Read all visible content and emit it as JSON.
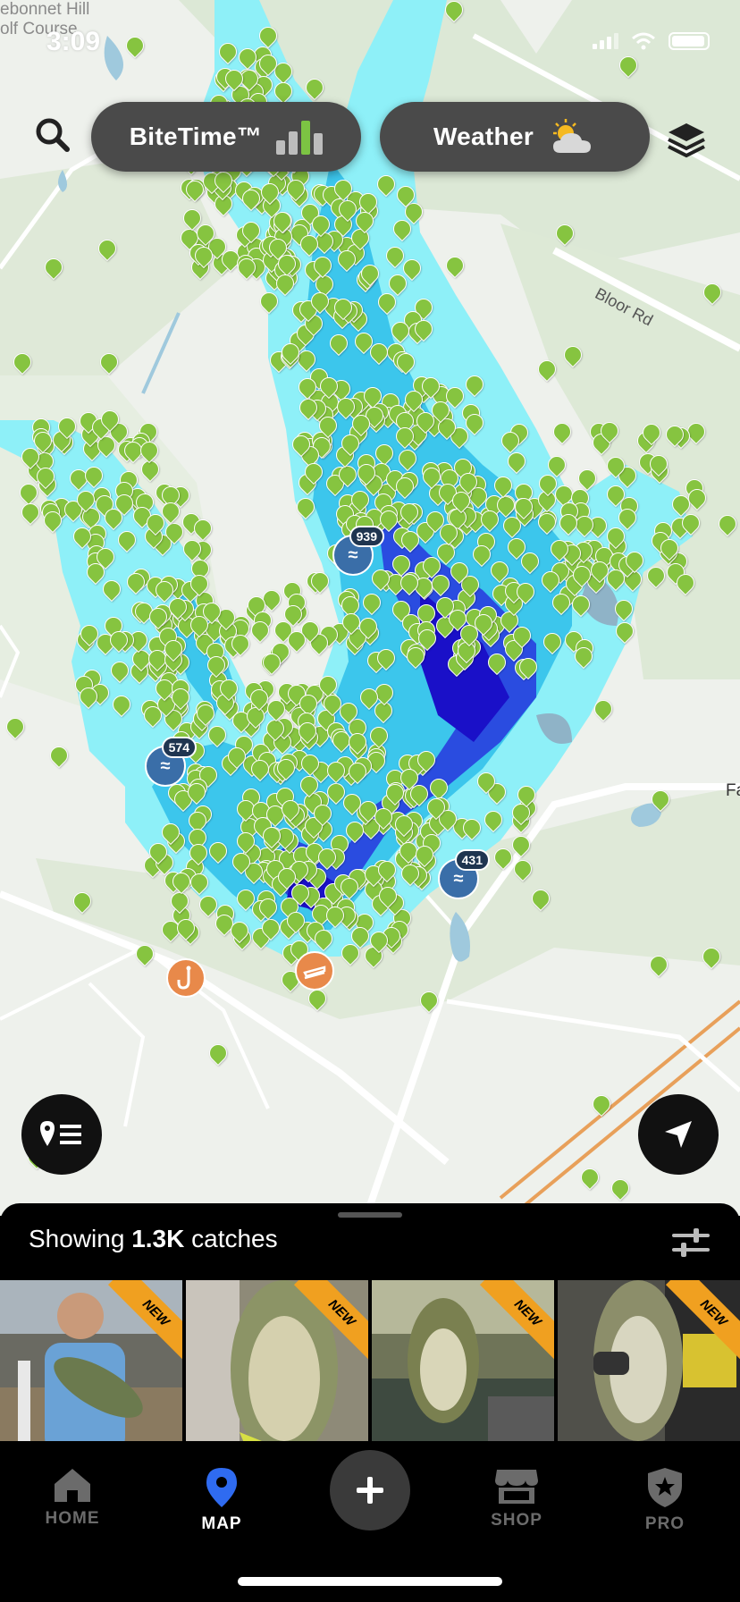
{
  "status_bar": {
    "time": "3:09"
  },
  "map": {
    "place_label": "ebonnet Hill\nolf Course",
    "road_labels": {
      "bloor": "Bloor Rd",
      "fa": "Fa"
    },
    "clusters": [
      {
        "count": "939"
      },
      {
        "count": "574"
      },
      {
        "count": "431"
      }
    ],
    "colors": {
      "pin": "#86c440",
      "water_shallow": "#7ee8f5",
      "water_deep": "#1a10c8",
      "cluster": "#3a6ea8"
    }
  },
  "top_controls": {
    "bitetime_label": "BiteTime™",
    "weather_label": "Weather"
  },
  "sheet": {
    "prefix": "Showing",
    "count": "1.3K",
    "suffix": "catches",
    "new_badge": "NEW",
    "thumbnails": [
      "thumb-1",
      "thumb-2",
      "thumb-3",
      "thumb-4"
    ]
  },
  "tabs": {
    "home": "HOME",
    "map": "MAP",
    "shop": "SHOP",
    "pro": "PRO",
    "active": "MAP",
    "active_color": "#2f6bf0"
  }
}
